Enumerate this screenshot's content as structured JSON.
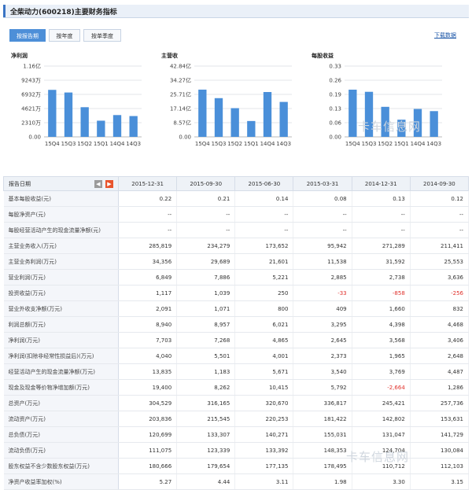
{
  "header": {
    "title": "全柴动力(600218)主要财务指标"
  },
  "tabs": [
    {
      "label": "按报告期",
      "active": true
    },
    {
      "label": "按年度",
      "active": false
    },
    {
      "label": "按单季度",
      "active": false
    }
  ],
  "download": "下载数据",
  "colors": {
    "bar": "#4a8fd9",
    "negative": "#e0312b",
    "accent": "#3a74c4"
  },
  "chart_data": [
    {
      "type": "bar",
      "title": "净利润",
      "categories": [
        "15Q4",
        "15Q3",
        "15Q2",
        "15Q1",
        "14Q4",
        "14Q3"
      ],
      "values": [
        0.77,
        0.727,
        0.486,
        0.265,
        0.357,
        0.341
      ],
      "ytick_labels": [
        "1.16亿",
        "9243万",
        "6932万",
        "4621万",
        "2310万",
        "0.00"
      ],
      "ylim": [
        0,
        1.16
      ]
    },
    {
      "type": "bar",
      "title": "主营收",
      "categories": [
        "15Q4",
        "15Q3",
        "15Q2",
        "15Q1",
        "14Q4",
        "14Q3"
      ],
      "values": [
        28.58,
        23.43,
        17.37,
        9.59,
        27.13,
        21.14
      ],
      "ytick_labels": [
        "42.84亿",
        "34.27亿",
        "25.71亿",
        "17.14亿",
        "8.57亿",
        "0.00"
      ],
      "ylim": [
        0,
        42.84
      ]
    },
    {
      "type": "bar",
      "title": "每股收益",
      "categories": [
        "15Q4",
        "15Q3",
        "15Q2",
        "15Q1",
        "14Q4",
        "14Q3"
      ],
      "values": [
        0.22,
        0.21,
        0.14,
        0.08,
        0.13,
        0.12
      ],
      "ytick_labels": [
        "0.33",
        "0.26",
        "0.19",
        "0.13",
        "0.06",
        "0.00"
      ],
      "ylim": [
        0,
        0.33
      ]
    }
  ],
  "watermark": "卡车信息网",
  "table": {
    "corner_label": "报告日期",
    "columns": [
      "2015-12-31",
      "2015-09-30",
      "2015-06-30",
      "2015-03-31",
      "2014-12-31",
      "2014-09-30"
    ],
    "rows": [
      {
        "label": "基本每股收益(元)",
        "values": [
          "0.22",
          "0.21",
          "0.14",
          "0.08",
          "0.13",
          "0.12"
        ]
      },
      {
        "label": "每股净资产(元)",
        "values": [
          "--",
          "--",
          "--",
          "--",
          "--",
          "--"
        ]
      },
      {
        "label": "每股经营活动产生的现金流量净额(元)",
        "values": [
          "--",
          "--",
          "--",
          "--",
          "--",
          "--"
        ]
      },
      {
        "label": "主营业务收入(万元)",
        "values": [
          "285,819",
          "234,279",
          "173,652",
          "95,942",
          "271,289",
          "211,411"
        ]
      },
      {
        "label": "主营业务利润(万元)",
        "values": [
          "34,356",
          "29,689",
          "21,601",
          "11,538",
          "31,592",
          "25,553"
        ]
      },
      {
        "label": "营业利润(万元)",
        "values": [
          "6,849",
          "7,886",
          "5,221",
          "2,885",
          "2,738",
          "3,636"
        ]
      },
      {
        "label": "投资收益(万元)",
        "values": [
          "1,117",
          "1,039",
          "250",
          "-33",
          "-858",
          "-256"
        ]
      },
      {
        "label": "营业外收支净额(万元)",
        "values": [
          "2,091",
          "1,071",
          "800",
          "409",
          "1,660",
          "832"
        ]
      },
      {
        "label": "利润总额(万元)",
        "values": [
          "8,940",
          "8,957",
          "6,021",
          "3,295",
          "4,398",
          "4,468"
        ]
      },
      {
        "label": "净利润(万元)",
        "values": [
          "7,703",
          "7,268",
          "4,865",
          "2,645",
          "3,568",
          "3,406"
        ]
      },
      {
        "label": "净利润(扣除非经常性损益后)(万元)",
        "values": [
          "4,040",
          "5,501",
          "4,001",
          "2,373",
          "1,965",
          "2,648"
        ]
      },
      {
        "label": "经营活动产生的现金流量净额(万元)",
        "values": [
          "13,835",
          "1,183",
          "5,671",
          "3,540",
          "3,769",
          "4,487"
        ]
      },
      {
        "label": "现金及现金等价物净增加额(万元)",
        "values": [
          "19,400",
          "8,262",
          "10,415",
          "5,792",
          "-2,664",
          "1,286"
        ]
      },
      {
        "label": "总资产(万元)",
        "values": [
          "304,529",
          "316,165",
          "320,670",
          "336,817",
          "245,421",
          "257,736"
        ]
      },
      {
        "label": "流动资产(万元)",
        "values": [
          "203,836",
          "215,545",
          "220,253",
          "181,422",
          "142,802",
          "153,631"
        ]
      },
      {
        "label": "总负债(万元)",
        "values": [
          "120,699",
          "133,307",
          "140,271",
          "155,031",
          "131,047",
          "141,729"
        ]
      },
      {
        "label": "流动负债(万元)",
        "values": [
          "111,075",
          "123,339",
          "133,392",
          "148,353",
          "124,704",
          "130,084"
        ]
      },
      {
        "label": "股东权益不含少数股东权益(万元)",
        "values": [
          "180,666",
          "179,654",
          "177,135",
          "178,495",
          "110,712",
          "112,103"
        ]
      },
      {
        "label": "净资产收益率加权(%)",
        "values": [
          "5.27",
          "4.44",
          "3.11",
          "1.98",
          "3.30",
          "3.15"
        ]
      }
    ]
  }
}
